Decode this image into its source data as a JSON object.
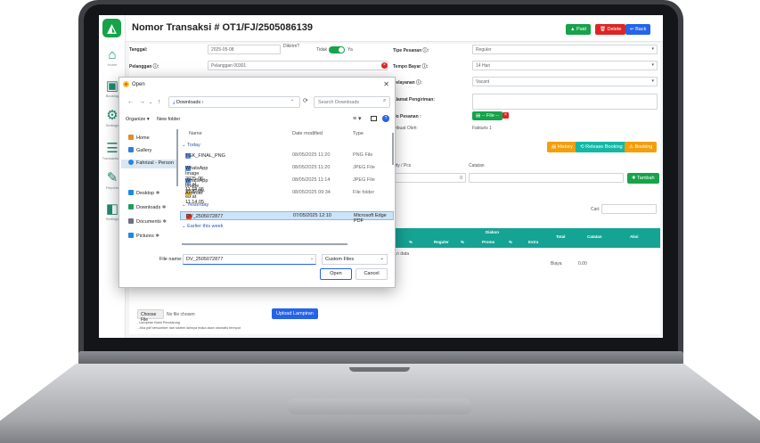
{
  "app": {
    "title": "Nomor Transaksi # OT1/FJ/2505086139",
    "logo_letter": "◭",
    "header_buttons": {
      "paid": "▲ Paid",
      "delete": "🗑 Delete",
      "back": "↩ Back"
    },
    "sidebar": [
      {
        "icon": "⌂",
        "label": "Home"
      },
      {
        "icon": "▣",
        "label": "Booking"
      },
      {
        "icon": "⚙",
        "label": "Settings"
      },
      {
        "icon": "☰",
        "label": "Transactions"
      },
      {
        "icon": "✎",
        "label": "Reports"
      },
      {
        "icon": "◧",
        "label": "Settings"
      }
    ],
    "form": {
      "tanggal_label": "Tanggal:",
      "tanggal_value": "2025-05-08",
      "dikirim_label": "Dikirim?",
      "dikirim_no": "Tidak",
      "dikirim_yes": "Ya",
      "pelanggan_label": "Pelanggan ⓘ:",
      "pelanggan_value": "Pelanggan 00301",
      "tipe_label": "Tipe Pesanan ⓘ:",
      "tipe_value": "Reguler",
      "tempo_label": "Tempo Bayar ⓘ:",
      "tempo_value": "14 Hari",
      "pelayanan_label": "Pelayanan ⓘ:",
      "pelayanan_value": "Vacant",
      "alamat_label": "Alamat Pengiriman:",
      "nopesanan_label": "No Pesanan :",
      "file_tag": "▤ -- File --",
      "dibuat_label": "Dibuat Oleh:",
      "dibuat_value": "Fakturis 1",
      "qty_label": "Qty / Pcs",
      "catatan_label": "Catatan",
      "qty_value": "0",
      "tambah": "✚ Tambah",
      "history": "▤ History",
      "release": "⟲ Release Booking",
      "booking": "⚠ Booking",
      "cari_label": "Cari:",
      "table_headers": {
        "diskon": "Diskon",
        "reguler": "Reguler",
        "promo": "Promo",
        "extra": "Extra",
        "total": "Total",
        "catatan": "Catatan",
        "aksi": "Aksi",
        "pct1": "%",
        "pct2": "%",
        "pct3": "%"
      },
      "no_data": "...n data",
      "biaya_label": "Biaya",
      "biaya_value": "0.00",
      "choose_file": "Choose File",
      "no_file": "No file chosen",
      "upload": "Upload Lampiran",
      "note1": "- Lampiran Bukti Pendukung",
      "note2": "- Jika pdf bersumber dari sistem lainnya maka akan otomatis terinput"
    }
  },
  "dialog": {
    "title": "Open",
    "path": "Downloads",
    "path_sep": "›",
    "search_placeholder": "Search Downloads",
    "organize": "Organize ▾",
    "new_folder": "New folder",
    "columns": {
      "name": "Name",
      "date": "Date modified",
      "type": "Type"
    },
    "groups": {
      "today": "Today",
      "yesterday": "Yesterday",
      "earlier": "Earlier this week"
    },
    "tree": [
      {
        "name": "Home",
        "color": "#e58a2a"
      },
      {
        "name": "Gallery",
        "color": "#2f7fd8"
      },
      {
        "name": "Fahrizal - Person",
        "color": "#1e88e5"
      },
      {
        "name": "Desktop",
        "color": "#1e88e5"
      },
      {
        "name": "Downloads",
        "color": "#1e9e5a"
      },
      {
        "name": "Documents",
        "color": "#6b7280"
      },
      {
        "name": "Pictures",
        "color": "#1e88e5"
      }
    ],
    "files_today": [
      {
        "name": "TGK_FINAL_PNG",
        "date": "08/05/2025 11:20",
        "type": "PNG File",
        "color": "#5b8dd6"
      },
      {
        "name": "WhatsApp Image 2025-05-08 at 11.14.05 (1)",
        "date": "08/05/2025 11:20",
        "type": "JPEG File",
        "color": "#5b8dd6"
      },
      {
        "name": "WhatsApp Image 2025-05-08 at 11.14.05",
        "date": "08/05/2025 11:14",
        "type": "JPEG File",
        "color": "#5b8dd6"
      },
      {
        "name": "Android",
        "date": "08/05/2025 09:34",
        "type": "File folder",
        "color": "#e8b93a"
      }
    ],
    "files_yesterday": [
      {
        "name": "DV_2505072877",
        "date": "07/05/2025 12:10",
        "type": "Microsoft Edge PDF",
        "color": "#d9412f"
      }
    ],
    "filename_label": "File name:",
    "filename_value": "DV_2505072877",
    "filetype_value": "Custom Files",
    "open_button": "Open",
    "cancel_button": "Cancel"
  }
}
